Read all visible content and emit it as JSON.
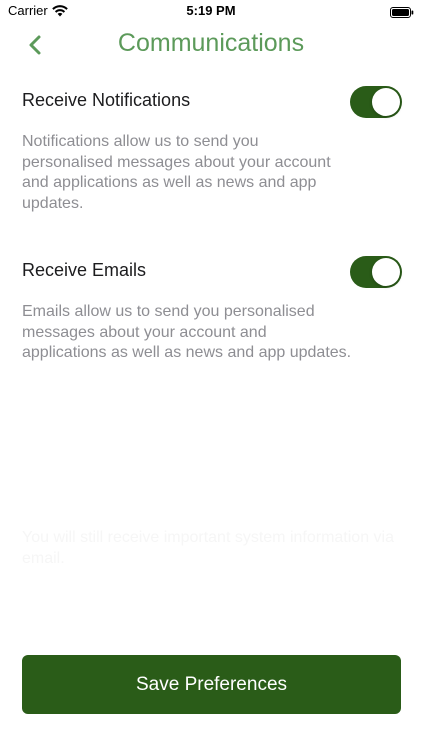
{
  "status_bar": {
    "carrier": "Carrier",
    "time": "5:19 PM",
    "wifi_icon": "wifi-icon",
    "battery_icon": "battery-icon"
  },
  "nav": {
    "title": "Communications",
    "back_icon": "chevron-left-icon"
  },
  "settings": [
    {
      "label": "Receive Notifications",
      "enabled": true,
      "description": "Notifications allow us to send you personalised messages about your account and applications as well as news and app updates."
    },
    {
      "label": "Receive Emails",
      "enabled": true,
      "description": "Emails allow us to send you personalised messages about your account and applications as well as news and app updates."
    }
  ],
  "system_note": "You will still receive important system information via email.",
  "save_button": {
    "label": "Save Preferences"
  },
  "colors": {
    "accent": "#5c9a5a",
    "primary": "#2a5c18",
    "secondary_text": "#8e8e93"
  }
}
